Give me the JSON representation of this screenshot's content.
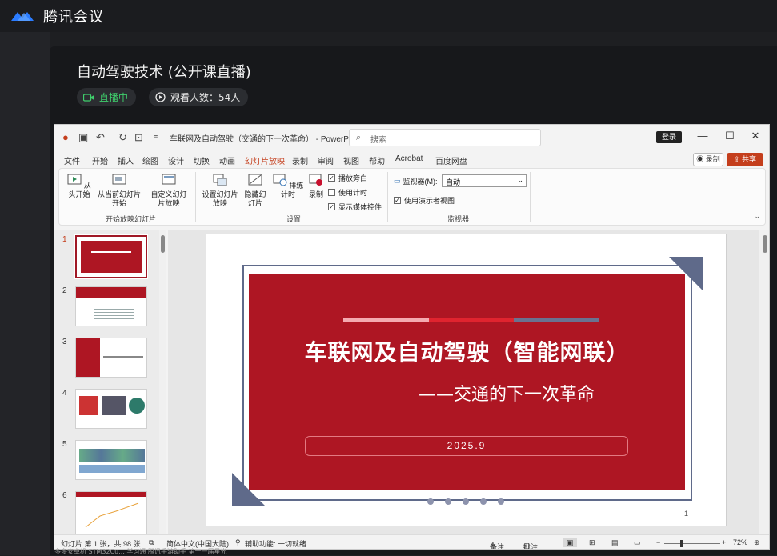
{
  "app": {
    "title": "腾讯会议"
  },
  "meeting": {
    "title": "自动驾驶技术 (公开课直播)",
    "live_label": "直播中",
    "viewers_label": "观看人数：54人"
  },
  "ppt": {
    "doc_title": "车联网及自动驾驶（交通的下一次革命） - PowerPo...",
    "search_placeholder": "搜索",
    "login": "登录",
    "menu": [
      "文件",
      "开始",
      "插入",
      "绘图",
      "设计",
      "切换",
      "动画",
      "幻灯片放映",
      "录制",
      "审阅",
      "视图",
      "帮助",
      "Acrobat",
      "百度网盘"
    ],
    "record_btn": "录制",
    "share_btn": "共享",
    "ribbon": {
      "from_start": "从头开始",
      "from_current": "从当前幻灯片开始",
      "custom": "自定义幻灯片放映",
      "group1": "开始放映幻灯片",
      "setup": "设置幻灯片放映",
      "hide": "隐藏幻灯片",
      "rehearse": "排练计时",
      "record": "录制",
      "chk_narration": "播放旁白",
      "chk_timing": "使用计时",
      "chk_media": "显示媒体控件",
      "group2": "设置",
      "monitor_label": "监视器(M):",
      "monitor_value": "自动",
      "presenter_view": "使用演示者视图",
      "group3": "监视器"
    },
    "thumbnails": [
      "1",
      "2",
      "3",
      "4",
      "5",
      "6"
    ],
    "slide": {
      "title": "车联网及自动驾驶（智能网联）",
      "subtitle": "——交通的下一次革命",
      "date": "2025.9",
      "page": "1"
    },
    "status": {
      "slide_count": "幻灯片 第 1 张，共 98 张",
      "language": "简体中文(中国大陆)",
      "accessibility": "辅助功能: 一切就绪",
      "notes": "备注",
      "comments": "批注",
      "zoom": "72%"
    }
  },
  "taskbar_text": "多多安卓机    STM32Cu...    学习通    腾讯手游助手 第十一届星光"
}
